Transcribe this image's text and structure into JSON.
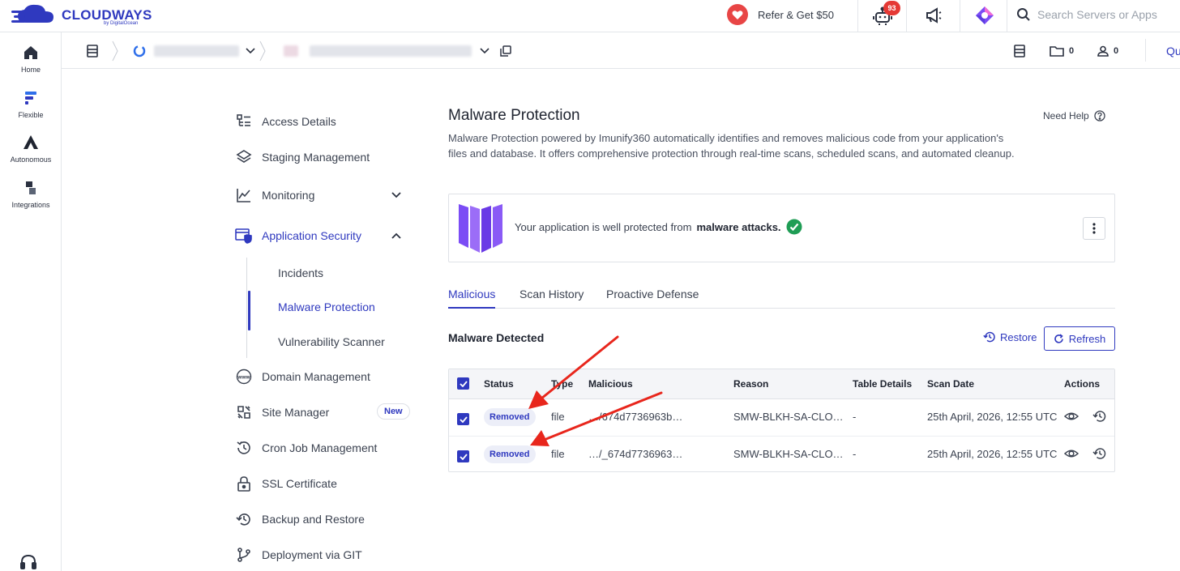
{
  "brand": {
    "name": "CLOUDWAYS",
    "sub": "by DigitalOcean",
    "color": "#2f39bf"
  },
  "topbar": {
    "refer_label": "Refer & Get $50",
    "notification_count": "93",
    "search_placeholder": "Search Servers or Apps"
  },
  "rail": {
    "items": [
      {
        "label": "Home",
        "icon": "home-icon"
      },
      {
        "label": "Flexible",
        "icon": "flexible-icon"
      },
      {
        "label": "Autonomous",
        "icon": "autonomous-icon"
      },
      {
        "label": "Integrations",
        "icon": "integrations-icon"
      }
    ]
  },
  "subheader": {
    "folder_count": "0",
    "user_count": "0",
    "cut_label": "Qu"
  },
  "nav": {
    "items": [
      {
        "label": "Access Details",
        "icon": "access-details-icon"
      },
      {
        "label": "Staging Management",
        "icon": "layers-icon"
      },
      {
        "label": "Monitoring",
        "icon": "chart-icon"
      },
      {
        "label": "Application Security",
        "icon": "app-security-icon"
      },
      {
        "label": "Domain Management",
        "icon": "www-icon"
      },
      {
        "label": "Site Manager",
        "icon": "site-manager-icon"
      },
      {
        "label": "Cron Job Management",
        "icon": "history-icon"
      },
      {
        "label": "SSL Certificate",
        "icon": "lock-icon"
      },
      {
        "label": "Backup and Restore",
        "icon": "restore-icon"
      },
      {
        "label": "Deployment via GIT",
        "icon": "git-branch-icon"
      }
    ],
    "sub_items": [
      "Incidents",
      "Malware Protection",
      "Vulnerability Scanner"
    ],
    "new_badge": "New"
  },
  "main": {
    "title": "Malware Protection",
    "need_help": "Need Help",
    "description": "Malware Protection powered by Imunify360 automatically identifies and removes malicious code from your application's files and database. It offers comprehensive protection through real-time scans, scheduled scans, and automated cleanup.",
    "status_prefix": "Your application is well protected from",
    "status_bold": "malware attacks.",
    "tabs": [
      "Malicious",
      "Scan History",
      "Proactive Defense"
    ],
    "section_title": "Malware Detected",
    "restore_label": "Restore",
    "refresh_label": "Refresh"
  },
  "table": {
    "headers": [
      "Status",
      "Type",
      "Malicious",
      "Reason",
      "Table Details",
      "Scan Date",
      "Actions"
    ],
    "rows": [
      {
        "status": "Removed",
        "type": "file",
        "malicious": "…/674d7736963b…",
        "reason": "SMW-BLKH-SA-CLO…",
        "table_details": "-",
        "scan_date": "25th April, 2026, 12:55 UTC"
      },
      {
        "status": "Removed",
        "type": "file",
        "malicious": "…/_674d7736963…",
        "reason": "SMW-BLKH-SA-CLO…",
        "table_details": "-",
        "scan_date": "25th April, 2026, 12:55 UTC"
      }
    ]
  },
  "colors": {
    "accent": "#2f39bf",
    "success": "#1f9d55",
    "danger": "#e53935",
    "arrow": "#e8261c"
  }
}
